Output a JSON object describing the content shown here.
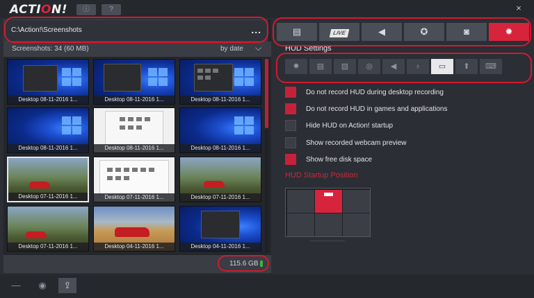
{
  "app": {
    "logo_text_a": "ACTI",
    "logo_text_o": "O",
    "logo_text_b": "N!",
    "info_icon": "info-icon",
    "help_icon": "help-icon",
    "close_glyph": "×"
  },
  "left": {
    "path": "C:\\Action!\\Screenshots",
    "more_glyph": "...",
    "count_label": "Screenshots: 34 (60 MB)",
    "sort_label": "by date",
    "free_space": "115.6 GB",
    "thumbnails": [
      {
        "caption": "Desktop 08-11-2016 1...",
        "kind": "win"
      },
      {
        "caption": "Desktop 08-11-2016 1...",
        "kind": "win"
      },
      {
        "caption": "Desktop 08-11-2016 1...",
        "kind": "win"
      },
      {
        "caption": "Desktop 08-11-2016 1...",
        "kind": "win"
      },
      {
        "caption": "Desktop 08-11-2016 1...",
        "kind": "white"
      },
      {
        "caption": "Desktop 08-11-2016 1...",
        "kind": "win"
      },
      {
        "caption": "Desktop 07-11-2016 1...",
        "kind": "race"
      },
      {
        "caption": "Desktop 07-11-2016 1...",
        "kind": "white"
      },
      {
        "caption": "Desktop 07-11-2016 1...",
        "kind": "race"
      },
      {
        "caption": "Desktop 07-11-2016 1...",
        "kind": "race"
      },
      {
        "caption": "Desktop 04-11-2016 1...",
        "kind": "sand"
      },
      {
        "caption": "Desktop 04-11-2016 1...",
        "kind": "win"
      }
    ]
  },
  "tabs": {
    "live_label": "LIVE",
    "items": [
      "film-icon",
      "live-icon",
      "speaker-icon",
      "gamepad-icon",
      "camera-icon",
      "gear-icon"
    ]
  },
  "hud": {
    "title": "HUD Settings",
    "tabs": [
      "gear-icon",
      "film-icon",
      "image-icon",
      "webcam-icon",
      "speaker-icon",
      "microphone-icon",
      "hud-window-icon",
      "upload-icon",
      "keyboard-icon"
    ],
    "options": [
      {
        "label": "Do not record HUD during desktop recording",
        "checked": true
      },
      {
        "label": "Do not record HUD in games and applications",
        "checked": true
      },
      {
        "label": "Hide HUD on Action! startup",
        "checked": false
      },
      {
        "label": "Show recorded webcam preview",
        "checked": false
      },
      {
        "label": "Show free disk space",
        "checked": true
      }
    ],
    "position_label": "HUD Startup Position"
  },
  "colors": {
    "accent": "#d8233d",
    "panel": "#2b2e34",
    "annotation": "#d31a30"
  }
}
